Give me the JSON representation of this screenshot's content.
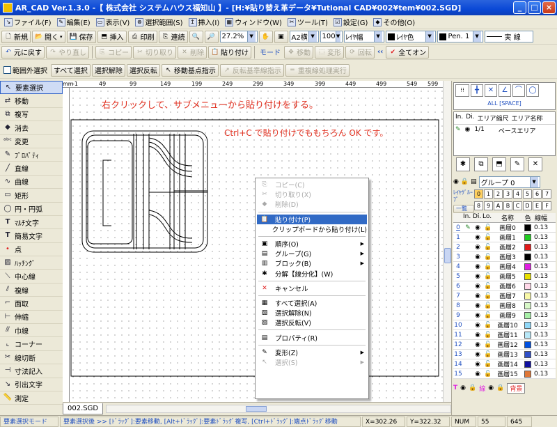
{
  "window": {
    "title": "AR_CAD Ver.1.3.0 -【 株式会社 システムハウス福知山 】- [H:¥貼り替え革データ¥Tutional CAD¥002¥tem¥002.SGD]",
    "buttons": [
      "_",
      "□",
      "×"
    ]
  },
  "menubar": [
    "ファイル(F)",
    "編集(E)",
    "表示(V)",
    "選択範囲(S)",
    "挿入(I)",
    "ウィンドウ(W)",
    "ツール(T)",
    "設定(G)",
    "その他(O)"
  ],
  "toolbar1": {
    "new": "新規",
    "open": "開く",
    "save": "保存",
    "insert": "挿入",
    "print": "印刷",
    "continuous": "連続",
    "zoom": "27.2%",
    "paper": "A2横",
    "scale": "100",
    "layer_color": "ﾚｲﾔ幅",
    "layer_color2": "ﾚｲﾔ色",
    "pen": "Pen. 1",
    "line_type": "実 線"
  },
  "toolbar2": {
    "undo": "元に戻す",
    "redo": "やり直し",
    "copy": "コピー",
    "cut": "切り取り",
    "delete": "削除",
    "paste": "貼り付け",
    "mode": "モード",
    "move": "移動",
    "transform": "変形",
    "rotate": "回転",
    "all_on": "全てオン"
  },
  "toolbar3": {
    "range_select": "範囲外選択",
    "select_all": "すべて選択",
    "deselect": "選択解除",
    "invert": "選択反転",
    "move_base": "移動基点指示",
    "reflect_base": "反転基準線指示",
    "overlap": "重複線処理実行"
  },
  "left_tools": [
    "要素選択",
    "移動",
    "複写",
    "消去",
    "変更",
    "ﾌﾟﾛﾊﾟﾃｨ",
    "直線",
    "曲線",
    "矩形",
    "円・円弧",
    "ﾏﾙﾁ文字",
    "簡易文字",
    "点",
    "ﾊｯﾁﾝｸﾞ",
    "中心線",
    "複線",
    "面取",
    "伸縮",
    "巾線",
    "コーナー",
    "線切断",
    "寸法記入",
    "引出文字",
    "測定"
  ],
  "ruler_ticks": [
    "-1",
    "49",
    "99",
    "149",
    "199",
    "249",
    "299",
    "349",
    "399",
    "449",
    "499",
    "549",
    "599"
  ],
  "canvas": {
    "annotation1": "右クリックして、サブメニューから貼り付けをする。",
    "annotation2": "Ctrl+C で貼り付けでももちろん OK です。"
  },
  "context_menu": [
    {
      "label": "コピー(C)",
      "disabled": true,
      "icon": "copy-icon"
    },
    {
      "label": "切り取り(X)",
      "disabled": true,
      "icon": "cut-icon"
    },
    {
      "label": "削除(D)",
      "disabled": true,
      "icon": "delete-icon"
    },
    {
      "sep": true
    },
    {
      "label": "貼り付け(P)",
      "selected": true,
      "icon": "paste-icon"
    },
    {
      "label": "クリップボードから貼り付け(L)",
      "icon": ""
    },
    {
      "sep": true
    },
    {
      "label": "順序(O)",
      "submenu": true,
      "icon": "order-icon"
    },
    {
      "label": "グループ(G)",
      "submenu": true,
      "icon": "group-icon"
    },
    {
      "label": "ブロック(B)",
      "submenu": true,
      "icon": "block-icon"
    },
    {
      "label": "分解【線分化】(W)",
      "icon": "explode-icon"
    },
    {
      "sep": true
    },
    {
      "label": "キャンセル",
      "icon": "cancel-icon"
    },
    {
      "sep": true
    },
    {
      "label": "すべて選択(A)",
      "icon": "select-all-icon"
    },
    {
      "label": "選択解除(N)",
      "icon": "deselect-icon"
    },
    {
      "label": "選択反転(V)",
      "icon": "invert-icon"
    },
    {
      "sep": true
    },
    {
      "label": "プロパティ(R)",
      "icon": "property-icon"
    },
    {
      "sep": true
    },
    {
      "label": "変形(Z)",
      "submenu": true,
      "icon": "transform-icon"
    },
    {
      "label": "選択(S)",
      "disabled": true,
      "submenu": true,
      "icon": "select-icon"
    }
  ],
  "right_panel": {
    "all_label": "ALL [SPACE]",
    "area_header": [
      "In.",
      "Di.",
      "エリア縮尺",
      "エリア名称"
    ],
    "area_row": {
      "scale": "1/1",
      "name": "ベースエリア"
    },
    "group": "グループ 0",
    "layer_group_label": "ﾚｲﾔｸﾞﾙｰﾌﾟ",
    "layer_group_nums": [
      "0",
      "1",
      "2",
      "3",
      "4",
      "5",
      "6",
      "7",
      "8",
      "9",
      "A",
      "B",
      "C",
      "D",
      "E",
      "F"
    ],
    "list_button": "一覧",
    "layer_header": [
      "In.",
      "Di.",
      "Lo.",
      "名称",
      "色",
      "線幅"
    ],
    "layers": [
      {
        "num": "0",
        "name": "画層0",
        "color": "#000000",
        "width": "0.13"
      },
      {
        "num": "1",
        "name": "画層1",
        "color": "#22cc22",
        "width": "0.13"
      },
      {
        "num": "2",
        "name": "画層2",
        "color": "#e01818",
        "width": "0.13"
      },
      {
        "num": "3",
        "name": "画層3",
        "color": "#000000",
        "width": "0.13"
      },
      {
        "num": "4",
        "name": "画層4",
        "color": "#e020e0",
        "width": "0.13"
      },
      {
        "num": "5",
        "name": "画層5",
        "color": "#e8e000",
        "width": "0.13"
      },
      {
        "num": "6",
        "name": "画層6",
        "color": "#ffd8e8",
        "width": "0.13"
      },
      {
        "num": "7",
        "name": "画層7",
        "color": "#f8f8a8",
        "width": "0.13"
      },
      {
        "num": "8",
        "name": "画層8",
        "color": "#d8f8c8",
        "width": "0.13"
      },
      {
        "num": "9",
        "name": "画層9",
        "color": "#a8f0a8",
        "width": "0.13"
      },
      {
        "num": "10",
        "name": "画層10",
        "color": "#90d8f8",
        "width": "0.13"
      },
      {
        "num": "11",
        "name": "画層11",
        "color": "#b8e8f8",
        "width": "0.13"
      },
      {
        "num": "12",
        "name": "画層12",
        "color": "#0050e0",
        "width": "0.13"
      },
      {
        "num": "13",
        "name": "画層13",
        "color": "#3050c8",
        "width": "0.13"
      },
      {
        "num": "14",
        "name": "画層14",
        "color": "#1010a0",
        "width": "0.13"
      },
      {
        "num": "15",
        "name": "画層15",
        "color": "#e07838",
        "width": "0.13"
      }
    ],
    "bottom_labels": {
      "t": "T",
      "line": "線",
      "background": "背景"
    }
  },
  "tab": "002.SGD",
  "status": {
    "mode": "要素選択モード",
    "hint": "要素選択後 >> [ﾄﾞﾗｯｸﾞ]:要素移動, [Alt+ﾄﾞﾗｯｸﾞ]:要素ﾄﾞﾗｯｸﾞ複写, [Ctrl+ﾄﾞﾗｯｸﾞ]:端点ﾄﾞﾗｯｸﾞ移動",
    "x": "X=302.26",
    "y": "Y=322.32",
    "num": "NUM",
    "n1": "55",
    "n2": "645"
  },
  "colors": {
    "title_bar": "#0a48d6",
    "selection": "#316ac5",
    "annotation": "#e03020",
    "drawing": "#000000"
  }
}
